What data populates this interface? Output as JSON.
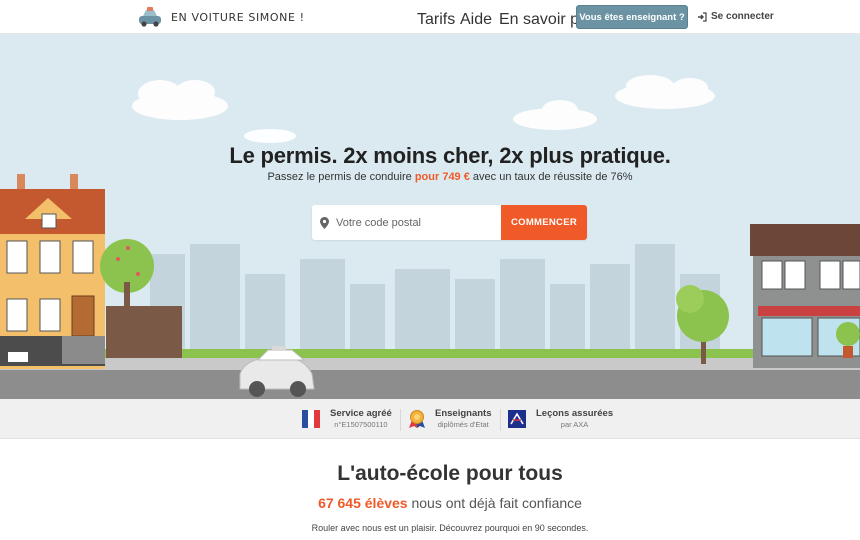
{
  "header": {
    "logo_text": "EN VOITURE SIMONE !",
    "nav": {
      "tarifs": "Tarifs",
      "aide": "Aide",
      "en_savoir_plus": "En savoir plus"
    },
    "teacher_button": "Vous êtes enseignant ?",
    "login": "Se connecter"
  },
  "hero": {
    "title": "Le permis. 2x moins cher, 2x plus pratique.",
    "subtitle_before": "Passez le permis de conduire ",
    "subtitle_price": "pour 749 €",
    "subtitle_after": " avec un taux de réussite de 76%",
    "search_placeholder": "Votre code postal",
    "search_button": "COMMENCER"
  },
  "trust": [
    {
      "title": "Service agréé",
      "sub": "n°E1507500110",
      "icon": "french-flag-icon"
    },
    {
      "title": "Enseignants",
      "sub": "diplômés d'Etat",
      "icon": "medal-icon"
    },
    {
      "title": "Leçons assurées",
      "sub": "par AXA",
      "icon": "axa-logo-icon"
    }
  ],
  "section": {
    "title": "L'auto-école pour tous",
    "count": "67 645 élèves",
    "count_after": " nous ont déjà fait confiance",
    "info": "Rouler avec nous est un plaisir. Découvrez pourquoi en 90 secondes."
  },
  "colors": {
    "accent": "#f05a28",
    "teacher_button": "#6b93a3",
    "sky": "#dbeaf1"
  }
}
